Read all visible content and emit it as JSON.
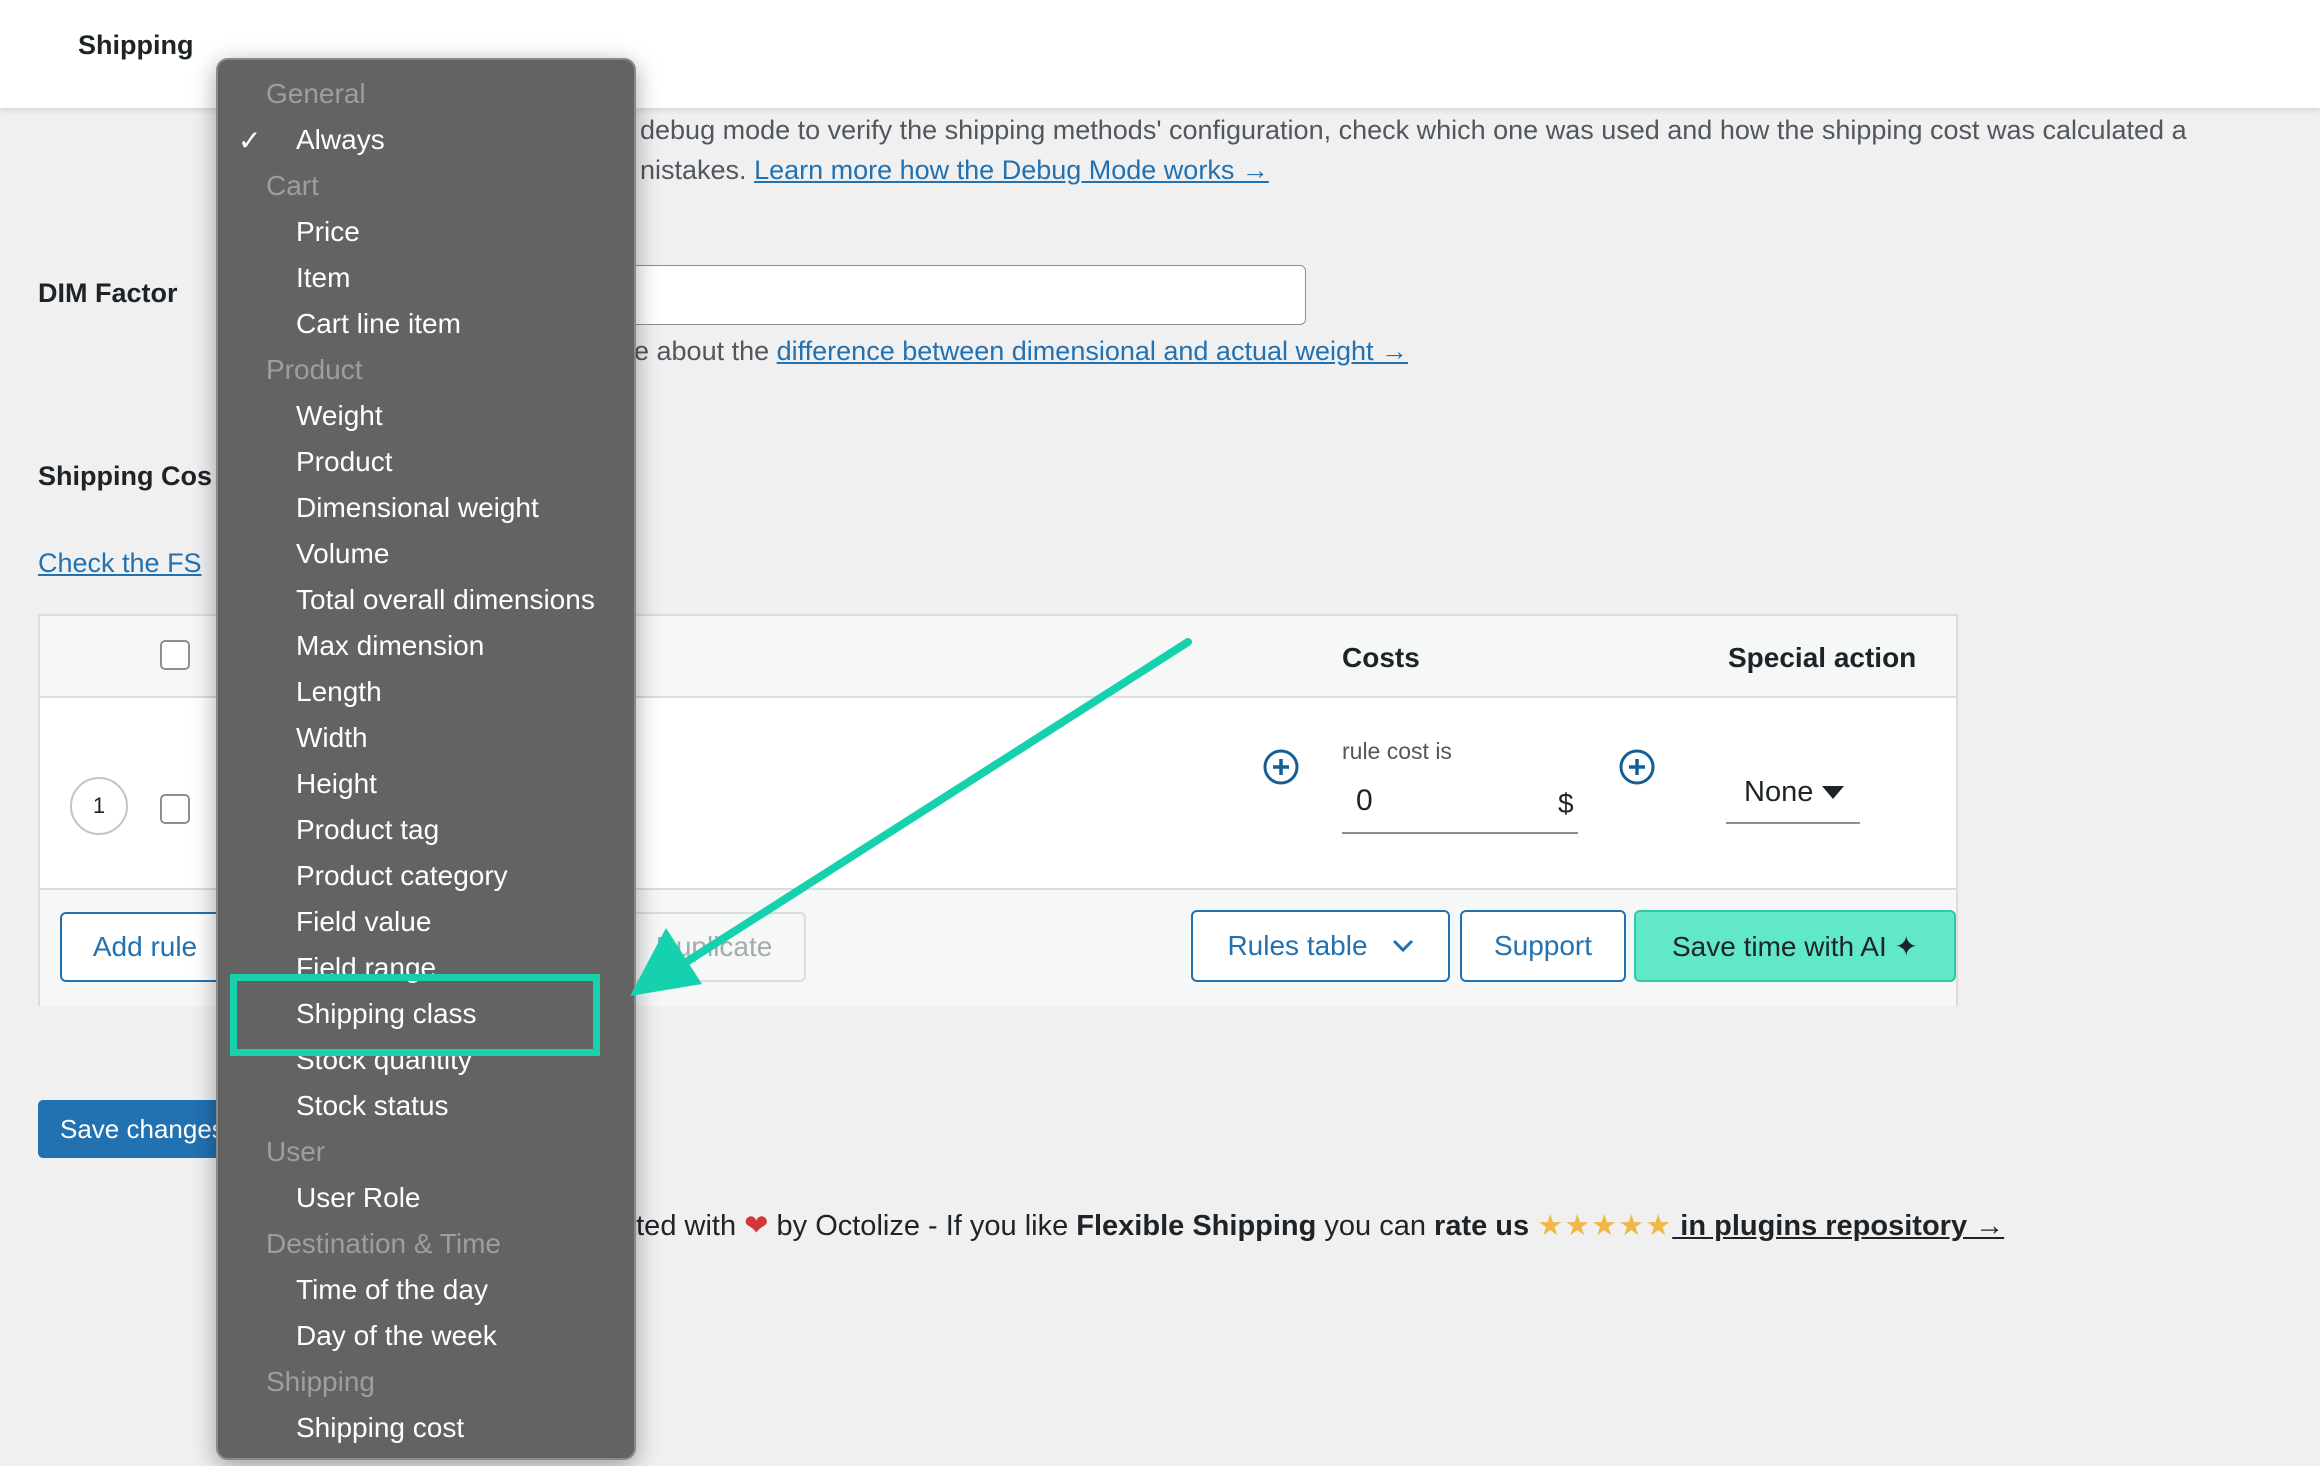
{
  "topbar": {
    "tab_label": "Shipping"
  },
  "debug": {
    "line1": "debug mode to verify the shipping methods' configuration, check which one was used and how the shipping cost was calculated a",
    "line2_prefix": "nistakes. ",
    "link": "Learn more how the Debug Mode works →"
  },
  "dim_factor": {
    "label": "DIM Factor",
    "desc_prefix": "e about the ",
    "link": "difference between dimensional and actual weight →"
  },
  "shipping_cost": {
    "label": "Shipping Cos",
    "check_link": "Check the FS "
  },
  "rules_table": {
    "headers": {
      "costs": "Costs",
      "special_action": "Special action"
    },
    "row": {
      "number": "1",
      "cost_label": "rule cost is",
      "cost_value": "0",
      "currency": "$",
      "special_action_value": "None"
    },
    "footer_buttons": {
      "add_rule": "Add rule",
      "duplicate": "Duplicate",
      "rules_table": "Rules table",
      "support": "Support",
      "save_ai": "Save time with AI ✦"
    }
  },
  "save_changes": "Save changes",
  "footer": {
    "prefix": "ated with",
    "heart": "❤",
    "by": " by Octolize - If you like ",
    "plugin": "Flexible Shipping",
    "middle": " you can ",
    "rate": "rate us",
    "stars": "★★★★★",
    "link": " in plugins repository →"
  },
  "dropdown": {
    "checkmark": "✓",
    "groups": [
      {
        "label": "General",
        "items": [
          "Always"
        ]
      },
      {
        "label": "Cart",
        "items": [
          "Price",
          "Item",
          "Cart line item"
        ]
      },
      {
        "label": "Product",
        "items": [
          "Weight",
          "Product",
          "Dimensional weight",
          "Volume",
          "Total overall dimensions",
          "Max dimension",
          "Length",
          "Width",
          "Height",
          "Product tag",
          "Product category",
          "Field value",
          "Field range",
          "Shipping class",
          "Stock quantity",
          "Stock status"
        ]
      },
      {
        "label": "User",
        "items": [
          "User Role"
        ]
      },
      {
        "label": "Destination & Time",
        "items": [
          "Time of the day",
          "Day of the week"
        ]
      },
      {
        "label": "Shipping",
        "items": [
          "Shipping cost"
        ]
      }
    ],
    "selected": "Always",
    "highlighted": "Shipping class"
  },
  "colors": {
    "accent": "#2271b1",
    "highlight": "#16d1ad",
    "ai_button": "#60e8c9",
    "dropdown_bg": "#636363"
  }
}
